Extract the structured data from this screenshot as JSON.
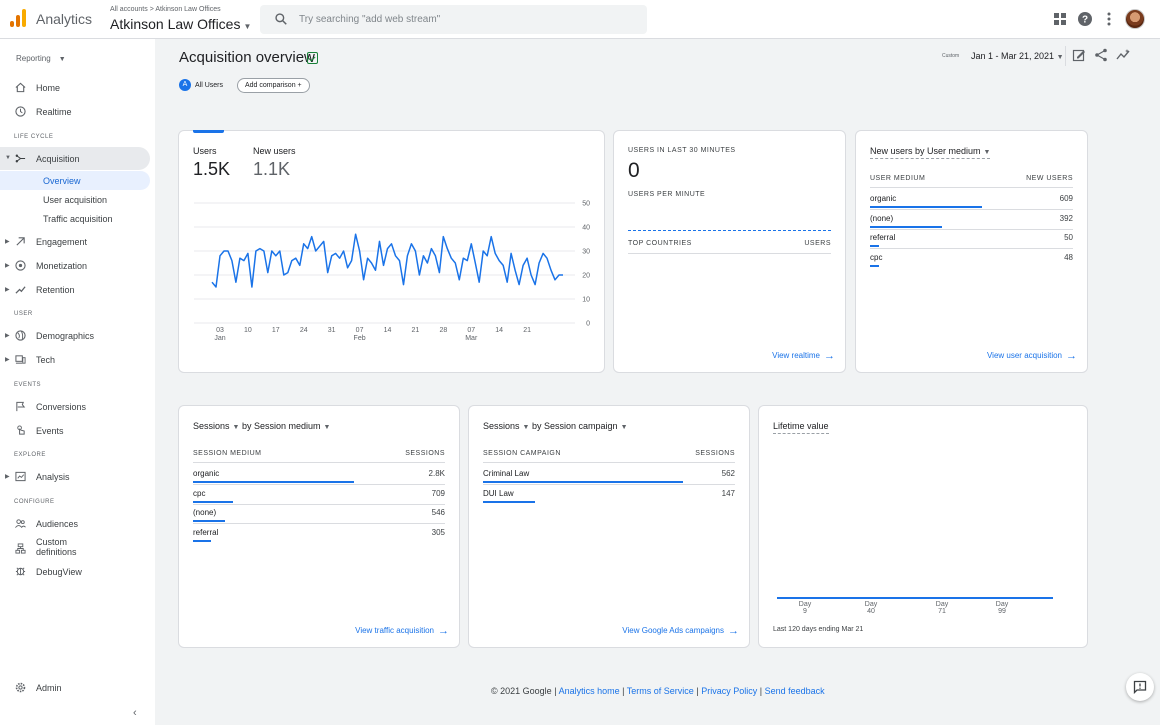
{
  "header": {
    "product": "Analytics",
    "breadcrumb_root": "All accounts",
    "breadcrumb_sep": ">",
    "breadcrumb_account": "Atkinson Law Offices",
    "account_name": "Atkinson Law Offices",
    "search_placeholder": "Try searching \"add web stream\""
  },
  "sidebar": {
    "reporting": "Reporting",
    "home": "Home",
    "realtime": "Realtime",
    "section_lifecycle": "LIFE CYCLE",
    "acquisition": "Acquisition",
    "acq_overview": "Overview",
    "acq_user": "User acquisition",
    "acq_traffic": "Traffic acquisition",
    "engagement": "Engagement",
    "monetization": "Monetization",
    "retention": "Retention",
    "section_user": "USER",
    "demographics": "Demographics",
    "tech": "Tech",
    "section_events": "EVENTS",
    "conversions": "Conversions",
    "events": "Events",
    "section_explore": "EXPLORE",
    "analysis": "Analysis",
    "section_configure": "CONFIGURE",
    "audiences": "Audiences",
    "custom_def_1": "Custom",
    "custom_def_2": "definitions",
    "debugview": "DebugView",
    "admin": "Admin"
  },
  "page": {
    "title": "Acquisition overview",
    "segment_letter": "A",
    "segment": "All Users",
    "add_comparison": "Add comparison",
    "date_label": "Custom",
    "date_range": "Jan 1 - Mar 21, 2021"
  },
  "users_card": {
    "metric1_label": "Users",
    "metric1_value": "1.5K",
    "metric2_label": "New users",
    "metric2_value": "1.1K",
    "chart_data": {
      "type": "line",
      "series": [
        {
          "values": [
            17,
            15,
            28,
            30,
            30,
            26,
            17,
            27,
            26,
            29,
            15,
            30,
            31,
            30,
            21,
            30,
            28,
            30,
            20,
            21,
            26,
            27,
            24,
            33,
            31,
            36,
            30,
            32,
            34,
            21,
            28,
            29,
            27,
            30,
            23,
            26,
            37,
            30,
            18,
            27,
            25,
            22,
            34,
            24,
            31,
            33,
            28,
            26,
            16,
            28,
            33,
            30,
            20,
            28,
            25,
            31,
            28,
            21,
            36,
            31,
            27,
            25,
            18,
            27,
            26,
            33,
            25,
            17,
            30,
            28,
            36,
            29,
            26,
            24,
            17,
            29,
            22,
            16,
            24,
            27,
            20,
            16,
            25,
            29,
            27,
            22,
            18,
            20,
            20
          ]
        }
      ],
      "ylim": [
        0,
        50
      ],
      "yticks": [
        "50",
        "40",
        "30",
        "20",
        "10",
        "0"
      ],
      "xticks": [
        "03",
        "10",
        "17",
        "24",
        "31",
        "07",
        "14",
        "21",
        "28",
        "07",
        "14",
        "21"
      ],
      "xmonths": [
        "Jan",
        "Feb",
        "Mar"
      ]
    }
  },
  "realtime_card": {
    "title": "USERS IN LAST 30 MINUTES",
    "value": "0",
    "per_minute": "USERS PER MINUTE",
    "col1": "TOP COUNTRIES",
    "col2": "USERS",
    "link": "View realtime"
  },
  "new_users_card": {
    "title": "New users by User medium",
    "col1": "USER MEDIUM",
    "col2": "NEW USERS",
    "rows": [
      {
        "label": "organic",
        "value": "609",
        "share": 1.0
      },
      {
        "label": "(none)",
        "value": "392",
        "share": 0.64
      },
      {
        "label": "referral",
        "value": "50",
        "share": 0.08
      },
      {
        "label": "cpc",
        "value": "48",
        "share": 0.08
      }
    ],
    "link": "View user acquisition"
  },
  "sessions_medium_card": {
    "metric": "Sessions",
    "dimension": "by Session medium",
    "col1": "SESSION MEDIUM",
    "col2": "SESSIONS",
    "rows": [
      {
        "label": "organic",
        "value": "2.8K",
        "share": 1.0
      },
      {
        "label": "cpc",
        "value": "709",
        "share": 0.25
      },
      {
        "label": "(none)",
        "value": "546",
        "share": 0.2
      },
      {
        "label": "referral",
        "value": "305",
        "share": 0.11
      }
    ],
    "link": "View traffic acquisition"
  },
  "sessions_campaign_card": {
    "metric": "Sessions",
    "dimension": "by Session campaign",
    "col1": "SESSION CAMPAIGN",
    "col2": "SESSIONS",
    "rows": [
      {
        "label": "Criminal Law",
        "value": "562",
        "share": 1.0
      },
      {
        "label": "DUI Law",
        "value": "147",
        "share": 0.26
      }
    ],
    "link": "View Google Ads campaigns"
  },
  "lifetime_card": {
    "title": "Lifetime value",
    "xticks": [
      [
        "Day",
        "9"
      ],
      [
        "Day",
        "40"
      ],
      [
        "Day",
        "71"
      ],
      [
        "Day",
        "99"
      ]
    ],
    "footnote": "Last 120 days ending Mar 21"
  },
  "footer": {
    "copyright": "© 2021 Google",
    "sep": "|",
    "link1": "Analytics home",
    "link2": "Terms of Service",
    "link3": "Privacy Policy",
    "link4": "Send feedback"
  },
  "colors": {
    "accent": "#1a73e8",
    "brand_orange": "#f9ab00"
  }
}
